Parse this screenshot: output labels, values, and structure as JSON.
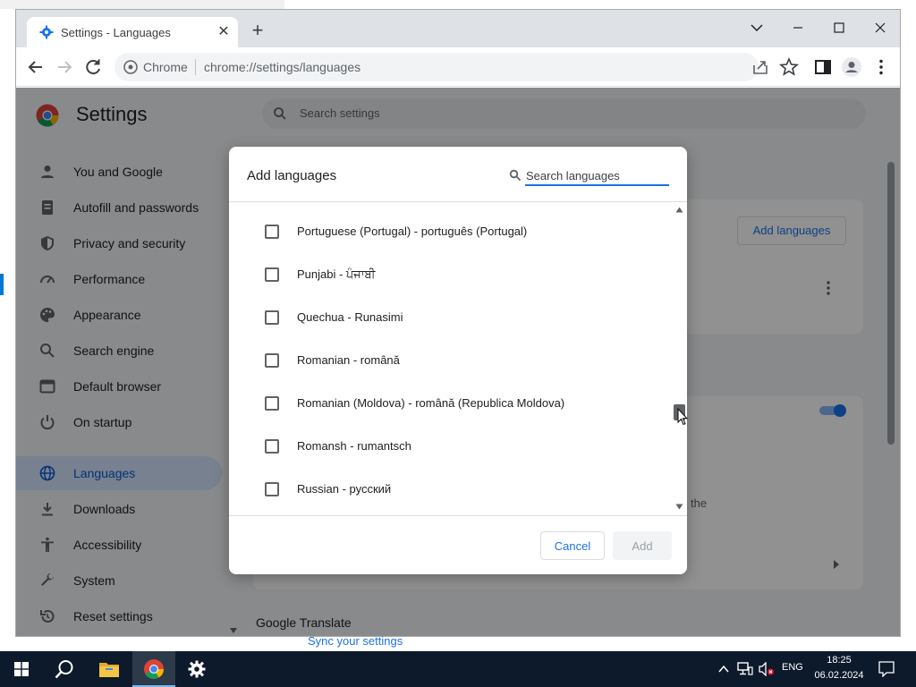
{
  "browser": {
    "tab_title": "Settings - Languages",
    "omnibox_site": "Chrome",
    "omnibox_url": "chrome://settings/languages"
  },
  "settings": {
    "title": "Settings",
    "search_placeholder": "Search settings",
    "nav": [
      {
        "label": "You and Google",
        "icon": "person-icon"
      },
      {
        "label": "Autofill and passwords",
        "icon": "autofill-icon"
      },
      {
        "label": "Privacy and security",
        "icon": "shield-icon"
      },
      {
        "label": "Performance",
        "icon": "speedometer-icon"
      },
      {
        "label": "Appearance",
        "icon": "palette-icon"
      },
      {
        "label": "Search engine",
        "icon": "search-icon"
      },
      {
        "label": "Default browser",
        "icon": "browser-icon"
      },
      {
        "label": "On startup",
        "icon": "power-icon"
      },
      {
        "label": "Languages",
        "icon": "globe-icon",
        "active": true
      },
      {
        "label": "Downloads",
        "icon": "download-icon"
      },
      {
        "label": "Accessibility",
        "icon": "accessibility-icon"
      },
      {
        "label": "System",
        "icon": "wrench-icon"
      },
      {
        "label": "Reset settings",
        "icon": "reset-icon"
      }
    ],
    "add_languages_button": "Add languages",
    "card_fragment": "the",
    "google_translate": "Google Translate",
    "sync_link": "Sync your settings"
  },
  "dialog": {
    "title": "Add languages",
    "search_placeholder": "Search languages",
    "languages": [
      {
        "label": "Portuguese (Portugal) - português (Portugal)",
        "checked": false
      },
      {
        "label": "Punjabi - ਪੰਜਾਬੀ",
        "checked": false
      },
      {
        "label": "Quechua - Runasimi",
        "checked": false
      },
      {
        "label": "Romanian - română",
        "checked": false
      },
      {
        "label": "Romanian (Moldova) - română (Republica Moldova)",
        "checked": false
      },
      {
        "label": "Romansh - rumantsch",
        "checked": false
      },
      {
        "label": "Russian - русский",
        "checked": false
      }
    ],
    "cancel_label": "Cancel",
    "add_label": "Add"
  },
  "taskbar": {
    "language": "ENG",
    "time": "18:25",
    "date": "06.02.2024"
  },
  "colors": {
    "accent": "#1a73e8",
    "taskbar": "#0c1a2b"
  }
}
